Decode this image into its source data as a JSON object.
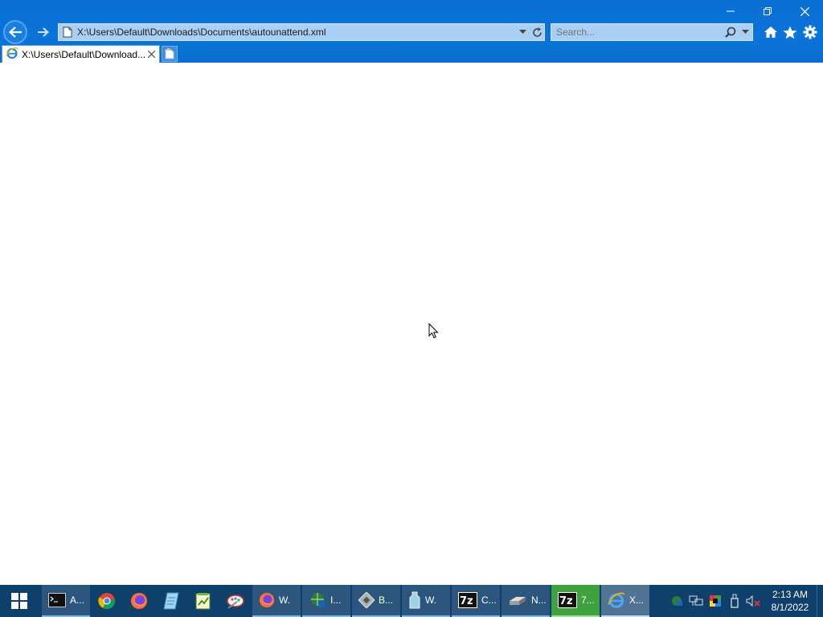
{
  "window": {
    "minimize_icon": "minimize-icon",
    "restore_icon": "restore-icon",
    "close_icon": "close-icon"
  },
  "nav": {
    "back_icon": "back-arrow-icon",
    "forward_icon": "forward-arrow-icon"
  },
  "address_bar": {
    "url": "X:\\Users\\Default\\Downloads\\Documents\\autounattend.xml",
    "page_icon": "page-icon",
    "dropdown_icon": "chevron-down-icon",
    "refresh_icon": "refresh-icon"
  },
  "search": {
    "placeholder": "Search...",
    "search_icon": "search-icon",
    "dropdown_icon": "chevron-down-icon"
  },
  "toolbar": {
    "home_icon": "home-icon",
    "favorites_icon": "star-icon",
    "settings_icon": "gear-icon"
  },
  "tabs": [
    {
      "label": "X:\\Users\\Default\\Download...",
      "icon": "ie-icon",
      "close_icon": "close-icon"
    }
  ],
  "new_tab_icon": "new-tab-icon",
  "taskbar": {
    "start_icon": "windows-icon",
    "items": [
      {
        "label": "A...",
        "icon": "terminal-icon"
      },
      {
        "label": "",
        "icon": "chrome-icon"
      },
      {
        "label": "",
        "icon": "firefox-icon"
      },
      {
        "label": "",
        "icon": "notepad-icon"
      },
      {
        "label": "",
        "icon": "spreadsheet-icon"
      },
      {
        "label": "",
        "icon": "paint-icon"
      },
      {
        "label": "W.",
        "icon": "firefox-icon"
      },
      {
        "label": "I...",
        "icon": "network-icon"
      },
      {
        "label": "B...",
        "icon": "tool-icon"
      },
      {
        "label": "W.",
        "icon": "bottle-icon"
      },
      {
        "label": "C...",
        "icon": "7zip-icon"
      },
      {
        "label": "N...",
        "icon": "drive-icon"
      },
      {
        "label": "7...",
        "icon": "7zip-icon"
      },
      {
        "label": "X...",
        "icon": "ie-icon"
      }
    ],
    "tray": {
      "icons": [
        "network-tray-icon",
        "display-tray-icon",
        "color-tray-icon",
        "usb-tray-icon",
        "volume-muted-icon"
      ],
      "time": "2:13 AM",
      "date": "8/1/2022"
    }
  }
}
